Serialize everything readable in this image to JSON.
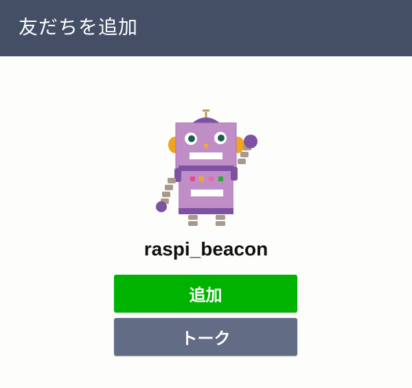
{
  "header": {
    "title": "友だちを追加",
    "background": "#444f66"
  },
  "profile": {
    "avatar_icon": "robot-illustration",
    "name": "raspi_beacon"
  },
  "actions": {
    "add_label": "追加",
    "add_color": "#00b300",
    "talk_label": "トーク",
    "talk_color": "#636c85"
  }
}
